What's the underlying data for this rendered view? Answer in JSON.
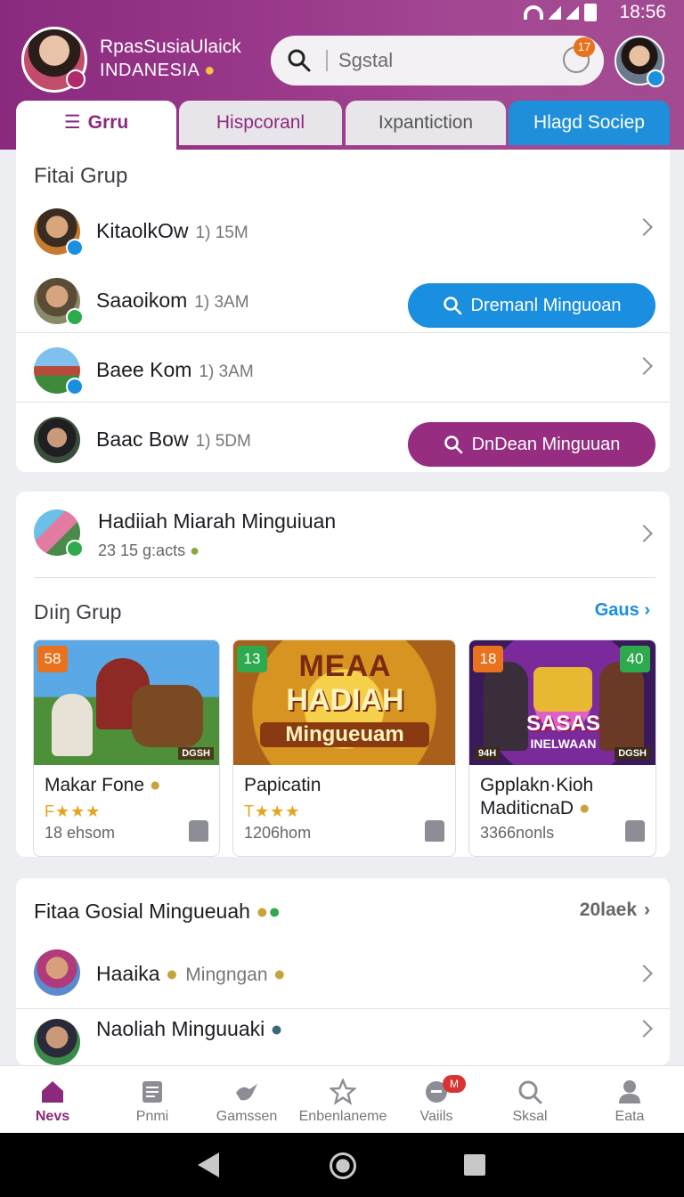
{
  "status": {
    "time": "18:56"
  },
  "header": {
    "brand_line1": "RpasSusiaUlaick",
    "brand_line2": "INDANESIA",
    "search_placeholder": "Sgstal",
    "notif_count": "17"
  },
  "tabs": [
    {
      "label": "Grru"
    },
    {
      "label": "Hispcoranl"
    },
    {
      "label": "Ixpantiction"
    },
    {
      "label": "Hlagd Sociep"
    }
  ],
  "groups": {
    "title": "Fitai Grup",
    "items": [
      {
        "name": "KitaolkOw",
        "meta": "1) 15M"
      },
      {
        "name": "Saaoikom",
        "meta": "1) 3AM",
        "button": "Dremanl Minguoan"
      },
      {
        "name": "Baee Kom",
        "meta": "1) 3AM"
      },
      {
        "name": "Baac Bow",
        "meta": "1) 5DM",
        "button": "DnDean Minguuan"
      }
    ]
  },
  "reward": {
    "title": "Hadiiah Miarah Minguiuan",
    "subtitle": "23 15 g:acts"
  },
  "drip": {
    "title": "Dıiŋ Grup",
    "see_all": "Gaus",
    "cards": [
      {
        "tag": "58",
        "name": "Makar Fone",
        "stars": "F★★★",
        "count": "18 ehsom",
        "thumb_caption": "DGSH"
      },
      {
        "tag": "13",
        "name": "Papicatin",
        "stars": "T★★★",
        "count": "1206hom",
        "thumb_line1": "MEAA",
        "thumb_line2": "HADIAH",
        "thumb_line3": "Mingueuam"
      },
      {
        "tag": "18",
        "tag2": "40",
        "name_line1": "Gpplakn·Kioh",
        "name_line2": "MaditicnaD",
        "count": "3366nonls",
        "thumb_line1": "SASAS",
        "thumb_line2": "INELWAAN",
        "thumb_caption_left": "94H",
        "thumb_caption_right": "DGSH"
      }
    ]
  },
  "social": {
    "title": "Fitaa Gosial Mingueuah",
    "right": "20laek",
    "items": [
      {
        "name": "Haaika",
        "meta": "Mingngan"
      },
      {
        "name": "Naoliah Minguuaki"
      }
    ]
  },
  "nav": [
    {
      "label": "Nevs",
      "icon": "home-icon"
    },
    {
      "label": "Pnmi",
      "icon": "document-icon"
    },
    {
      "label": "Gamssen",
      "icon": "bird-icon"
    },
    {
      "label": "Enbenlaneme",
      "icon": "star-icon"
    },
    {
      "label": "Vaiils",
      "icon": "chat-icon",
      "badge": "M"
    },
    {
      "label": "Sksal",
      "icon": "search-icon"
    },
    {
      "label": "Eata",
      "icon": "person-icon"
    }
  ],
  "colors": {
    "brand_purple": "#8b2a7d",
    "accent_blue": "#1a8fe0"
  }
}
